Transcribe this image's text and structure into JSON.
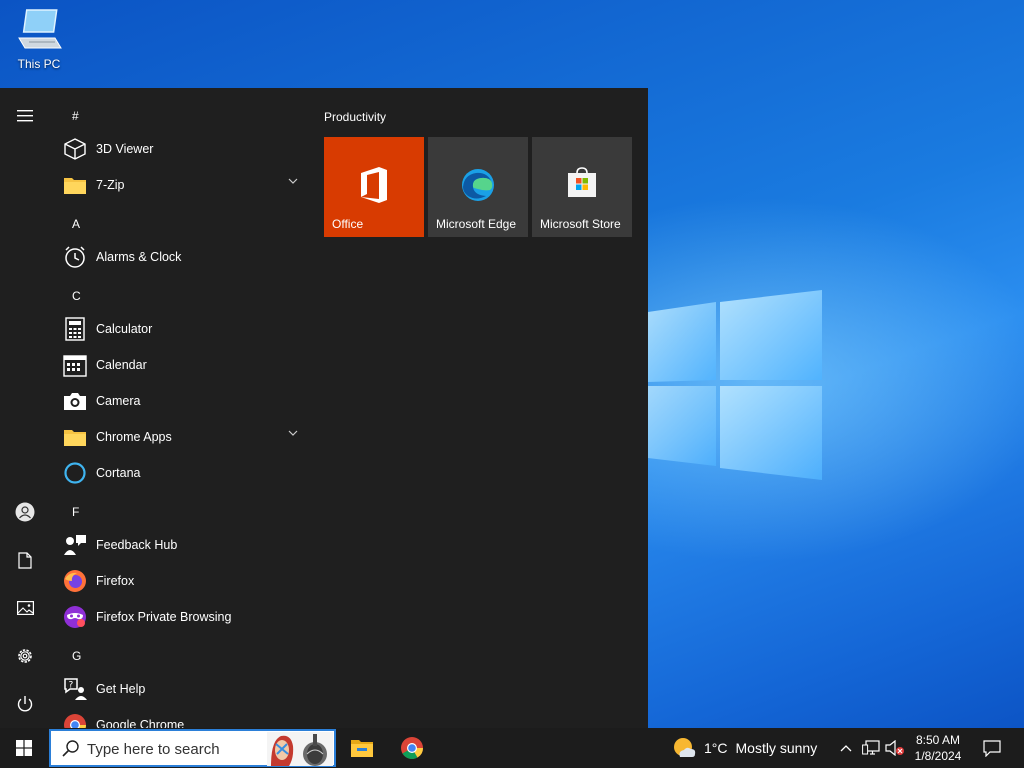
{
  "desktop": {
    "icons": [
      {
        "label": "This PC",
        "icon": "computer-icon"
      }
    ]
  },
  "start_menu": {
    "rail": {
      "menu_icon": "hamburger-icon",
      "account_icon": "user-account-icon",
      "documents_icon": "document-icon",
      "pictures_icon": "pictures-icon",
      "settings_icon": "gear-icon",
      "power_icon": "power-icon"
    },
    "letters": {
      "hash": "#",
      "a": "A",
      "c": "C",
      "f": "F",
      "g": "G"
    },
    "apps": {
      "viewer3d": {
        "label": "3D Viewer",
        "icon": "cube-icon"
      },
      "zip7": {
        "label": "7-Zip",
        "icon": "folder-icon",
        "expandable": true
      },
      "alarms": {
        "label": "Alarms & Clock",
        "icon": "clock-icon"
      },
      "calculator": {
        "label": "Calculator",
        "icon": "calculator-icon"
      },
      "calendar": {
        "label": "Calendar",
        "icon": "calendar-icon"
      },
      "camera": {
        "label": "Camera",
        "icon": "camera-icon"
      },
      "chrome_apps": {
        "label": "Chrome Apps",
        "icon": "folder-icon",
        "expandable": true
      },
      "cortana": {
        "label": "Cortana",
        "icon": "cortana-ring-icon"
      },
      "feedback": {
        "label": "Feedback Hub",
        "icon": "feedback-icon"
      },
      "firefox": {
        "label": "Firefox",
        "icon": "firefox-icon"
      },
      "firefox_private": {
        "label": "Firefox Private Browsing",
        "icon": "firefox-private-icon"
      },
      "get_help": {
        "label": "Get Help",
        "icon": "help-icon"
      },
      "google_chrome": {
        "label": "Google Chrome",
        "icon": "chrome-icon"
      }
    },
    "tiles_group": "Productivity",
    "tiles": {
      "office": {
        "label": "Office",
        "color": "#d83b01",
        "icon": "office-icon"
      },
      "edge": {
        "label": "Microsoft Edge",
        "color": "#3a3a3a",
        "icon": "edge-icon"
      },
      "store": {
        "label": "Microsoft Store",
        "color": "#3a3a3a",
        "icon": "store-icon"
      }
    }
  },
  "taskbar": {
    "start_icon": "windows-logo-icon",
    "search": {
      "placeholder": "Type here to search",
      "icon": "search-icon"
    },
    "pinned": [
      {
        "name": "File Explorer",
        "icon": "file-explorer-icon"
      },
      {
        "name": "Google Chrome",
        "icon": "chrome-icon"
      }
    ],
    "weather": {
      "temp": "1°C",
      "desc": "Mostly sunny",
      "icon": "partly-sunny-icon"
    },
    "tray": {
      "chevron_icon": "chevron-up-icon",
      "network_icon": "network-icon",
      "volume_icon": "volume-muted-icon"
    },
    "clock": {
      "time": "8:50 AM",
      "date": "1/8/2024"
    },
    "notifications_icon": "notification-icon"
  },
  "colors": {
    "accent": "#2b7fd8",
    "office": "#d83b01",
    "start_bg": "#1f1f1f",
    "taskbar_bg": "#1c1c1c"
  }
}
